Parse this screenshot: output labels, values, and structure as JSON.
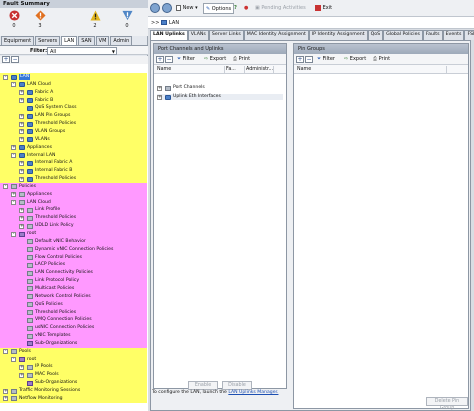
{
  "left_panel": {
    "title": "Fault Summary",
    "fault_counts": [
      {
        "icon": "critical-fault-icon",
        "count": "0",
        "color": "#c83232"
      },
      {
        "icon": "major-fault-icon",
        "count": "3",
        "color": "#e07020"
      },
      {
        "icon": "minor-fault-icon",
        "count": "2",
        "color": "#e2b51e"
      },
      {
        "icon": "warning-fault-icon",
        "count": "0",
        "color": "#4f86c6"
      }
    ],
    "tabs": [
      "Equipment",
      "Servers",
      "LAN",
      "SAN",
      "VM",
      "Admin"
    ],
    "active_tab": "LAN",
    "filter_label": "Filter:",
    "filter_value": "All",
    "band_colors": {
      "yellow": "#ffff66",
      "pink": "#ff99ff"
    },
    "tree": [
      {
        "label": "LAN",
        "depth": 0,
        "band": "yellow",
        "selected": true,
        "expander": "-",
        "icon": "i-blue"
      },
      {
        "label": "LAN Cloud",
        "depth": 1,
        "band": "yellow",
        "expander": "-",
        "icon": "i-blue"
      },
      {
        "label": "Fabric A",
        "depth": 2,
        "band": "yellow",
        "expander": "+",
        "icon": "i-blue"
      },
      {
        "label": "Fabric B",
        "depth": 2,
        "band": "yellow",
        "expander": "+",
        "icon": "i-blue"
      },
      {
        "label": "QoS System Class",
        "depth": 2,
        "band": "yellow",
        "icon": "i-blue"
      },
      {
        "label": "LAN Pin Groups",
        "depth": 2,
        "band": "yellow",
        "expander": "+",
        "icon": "i-blue"
      },
      {
        "label": "Threshold Policies",
        "depth": 2,
        "band": "yellow",
        "expander": "+",
        "icon": "i-blue"
      },
      {
        "label": "VLAN Groups",
        "depth": 2,
        "band": "yellow",
        "expander": "+",
        "icon": "i-blue"
      },
      {
        "label": "VLANs",
        "depth": 2,
        "band": "yellow",
        "expander": "+",
        "icon": "i-blue"
      },
      {
        "label": "Appliances",
        "depth": 1,
        "band": "yellow",
        "expander": "+",
        "icon": "i-blue"
      },
      {
        "label": "Internal LAN",
        "depth": 1,
        "band": "yellow",
        "expander": "-",
        "icon": "i-blue"
      },
      {
        "label": "Internal Fabric A",
        "depth": 2,
        "band": "yellow",
        "expander": "+",
        "icon": "i-blue"
      },
      {
        "label": "Internal Fabric B",
        "depth": 2,
        "band": "yellow",
        "expander": "+",
        "icon": "i-blue"
      },
      {
        "label": "Threshold Policies",
        "depth": 2,
        "band": "yellow",
        "expander": "+",
        "icon": "i-blue"
      },
      {
        "label": "Policies",
        "depth": 0,
        "band": "pink",
        "expander": "-",
        "icon": "i-gray"
      },
      {
        "label": "Appliances",
        "depth": 1,
        "band": "pink",
        "expander": "+",
        "icon": "i-gray"
      },
      {
        "label": "LAN Cloud",
        "depth": 1,
        "band": "pink",
        "expander": "-",
        "icon": "i-gray"
      },
      {
        "label": "Link Profile",
        "depth": 2,
        "band": "pink",
        "expander": "+",
        "icon": "i-gray"
      },
      {
        "label": "Threshold Policies",
        "depth": 2,
        "band": "pink",
        "expander": "+",
        "icon": "i-gray"
      },
      {
        "label": "UDLD Link Policy",
        "depth": 2,
        "band": "pink",
        "expander": "+",
        "icon": "i-gray"
      },
      {
        "label": "root",
        "depth": 1,
        "band": "pink",
        "expander": "-",
        "icon": "i-purple"
      },
      {
        "label": "Default vNIC Behavior",
        "depth": 2,
        "band": "pink",
        "icon": "i-gray"
      },
      {
        "label": "Dynamic vNIC Connection Policies",
        "depth": 2,
        "band": "pink",
        "icon": "i-gray"
      },
      {
        "label": "Flow Control Policies",
        "depth": 2,
        "band": "pink",
        "icon": "i-gray"
      },
      {
        "label": "LACP Policies",
        "depth": 2,
        "band": "pink",
        "icon": "i-gray"
      },
      {
        "label": "LAN Connectivity Policies",
        "depth": 2,
        "band": "pink",
        "icon": "i-gray"
      },
      {
        "label": "Link Protocol Policy",
        "depth": 2,
        "band": "pink",
        "icon": "i-gray"
      },
      {
        "label": "Multicast Policies",
        "depth": 2,
        "band": "pink",
        "icon": "i-gray"
      },
      {
        "label": "Network Control Policies",
        "depth": 2,
        "band": "pink",
        "icon": "i-gray"
      },
      {
        "label": "QoS Policies",
        "depth": 2,
        "band": "pink",
        "icon": "i-gray"
      },
      {
        "label": "Threshold Policies",
        "depth": 2,
        "band": "pink",
        "icon": "i-gray"
      },
      {
        "label": "VMQ Connection Policies",
        "depth": 2,
        "band": "pink",
        "icon": "i-gray"
      },
      {
        "label": "usNIC Connection Policies",
        "depth": 2,
        "band": "pink",
        "icon": "i-gray"
      },
      {
        "label": "vNIC Templates",
        "depth": 2,
        "band": "pink",
        "icon": "i-gray"
      },
      {
        "label": "Sub-Organizations",
        "depth": 2,
        "band": "pink",
        "icon": "i-purple"
      },
      {
        "label": "Pools",
        "depth": 0,
        "band": "yellow",
        "expander": "-",
        "icon": "i-gray"
      },
      {
        "label": "root",
        "depth": 1,
        "band": "yellow",
        "expander": "-",
        "icon": "i-purple"
      },
      {
        "label": "IP Pools",
        "depth": 2,
        "band": "yellow",
        "expander": "+",
        "icon": "i-gray"
      },
      {
        "label": "MAC Pools",
        "depth": 2,
        "band": "yellow",
        "expander": "+",
        "icon": "i-gray"
      },
      {
        "label": "Sub-Organizations",
        "depth": 2,
        "band": "yellow",
        "icon": "i-purple"
      },
      {
        "label": "Traffic Monitoring Sessions",
        "depth": 0,
        "band": "yellow",
        "expander": "+",
        "icon": "i-gray"
      },
      {
        "label": "Netflow Monitoring",
        "depth": 0,
        "band": "yellow",
        "expander": "+",
        "icon": "i-gray"
      }
    ]
  },
  "toolbar": {
    "new_label": "New",
    "options_label": "Options",
    "pending_label": "Pending Activities",
    "exit_label": "Exit"
  },
  "breadcrumb": {
    "prefix": ">>",
    "current": "LAN"
  },
  "right_tabs": [
    "LAN Uplinks",
    "VLANs",
    "Server Links",
    "MAC Identity Assignment",
    "IP Identity Assignment",
    "QoS",
    "Global Policies",
    "Faults",
    "Events",
    "FSM"
  ],
  "active_right_tab": "LAN Uplinks",
  "port_channels_pane": {
    "title": "Port Channels and Uplinks",
    "filter_label": "Filter",
    "export_label": "Export",
    "print_label": "Print",
    "columns": [
      "Name",
      "Fa...",
      "Administr..."
    ],
    "rows": [
      {
        "label": "Port Channels",
        "expander": "+"
      },
      {
        "label": "Uplink Eth Interfaces",
        "expander": "+"
      }
    ],
    "enable_label": "Enable",
    "disable_label": "Disable"
  },
  "pin_groups_pane": {
    "title": "Pin Groups",
    "filter_label": "Filter",
    "export_label": "Export",
    "print_label": "Print",
    "columns": [
      "Name"
    ],
    "delete_label": "Delete Pin Group"
  },
  "note": {
    "text": "To configure the LAN, launch the",
    "link": "LAN Uplinks Manager."
  }
}
